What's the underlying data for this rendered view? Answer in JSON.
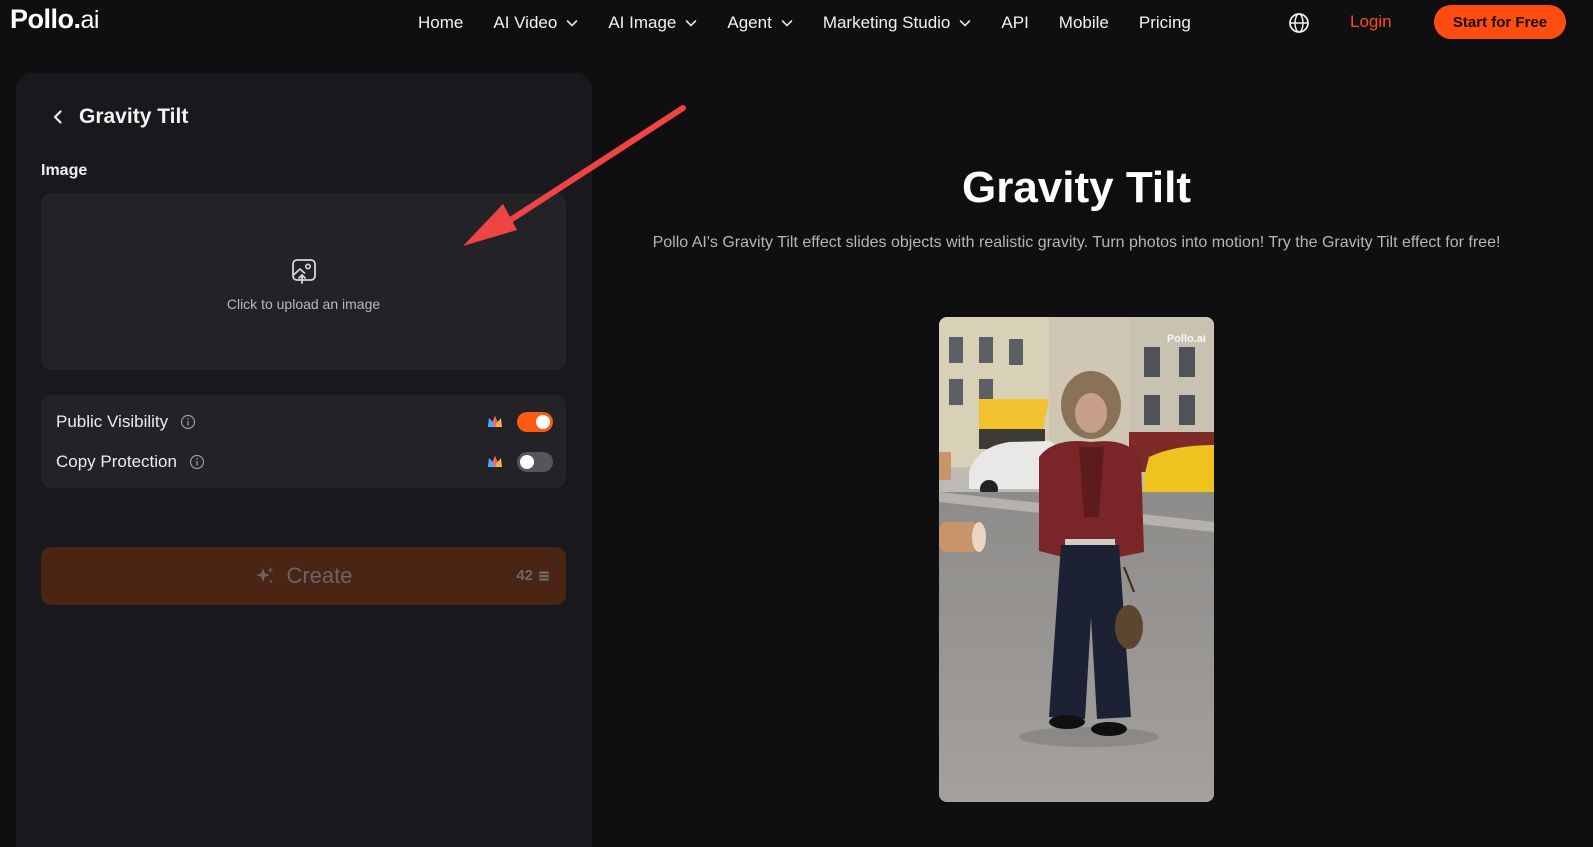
{
  "header": {
    "logo_main": "Pollo",
    "logo_dot": ".",
    "logo_suffix": "ai",
    "nav": [
      {
        "label": "Home",
        "dropdown": false
      },
      {
        "label": "AI Video",
        "dropdown": true
      },
      {
        "label": "AI Image",
        "dropdown": true
      },
      {
        "label": "Agent",
        "dropdown": true
      },
      {
        "label": "Marketing Studio",
        "dropdown": true
      },
      {
        "label": "API",
        "dropdown": false
      },
      {
        "label": "Mobile",
        "dropdown": false
      },
      {
        "label": "Pricing",
        "dropdown": false
      }
    ],
    "login_label": "Login",
    "cta_label": "Start for Free"
  },
  "panel": {
    "title": "Gravity Tilt",
    "image_label": "Image",
    "upload_text": "Click to upload an image",
    "public_visibility": {
      "label": "Public Visibility",
      "enabled": true
    },
    "copy_protection": {
      "label": "Copy Protection",
      "enabled": false
    },
    "create_label": "Create",
    "credits": "42"
  },
  "main": {
    "title": "Gravity Tilt",
    "description": "Pollo AI's Gravity Tilt effect slides objects with realistic gravity. Turn photos into motion! Try the Gravity Tilt effect for free!",
    "watermark": "Pollo.ai"
  },
  "colors": {
    "accent": "#ff4d12",
    "login": "#ff4a1c",
    "background": "#0f0f12",
    "panel": "#19191d"
  }
}
